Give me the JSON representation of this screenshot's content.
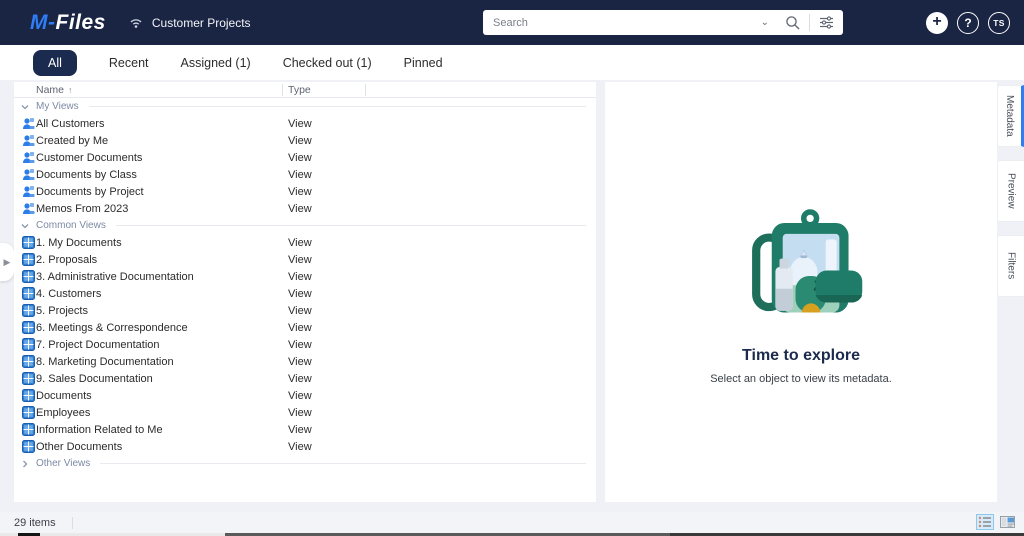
{
  "colors": {
    "topbar_bg": "#1a2443",
    "accent_blue": "#2e7df6",
    "active_tab_bg": "#1b2a4f",
    "illustration_teal": "#1f7c68"
  },
  "topbar": {
    "logo_prefix": "M-",
    "logo_suffix": "Files",
    "vault_name": "Customer Projects",
    "search": {
      "placeholder": "Search"
    },
    "avatar_initials": "TS",
    "plus_glyph": "+",
    "help_glyph": "?"
  },
  "tabs": [
    {
      "label": "All",
      "active": true
    },
    {
      "label": "Recent",
      "active": false
    },
    {
      "label": "Assigned (1)",
      "active": false
    },
    {
      "label": "Checked out (1)",
      "active": false
    },
    {
      "label": "Pinned",
      "active": false
    }
  ],
  "listing": {
    "columns": [
      {
        "label": "Name",
        "sort": "asc"
      },
      {
        "label": "Type",
        "sort": null
      }
    ],
    "groups": [
      {
        "label": "My Views",
        "expanded": true,
        "icon": "person",
        "item_type": "View",
        "items": [
          "All Customers",
          "Created by Me",
          "Customer Documents",
          "Documents by Class",
          "Documents by Project",
          "Memos From 2023"
        ]
      },
      {
        "label": "Common Views",
        "expanded": true,
        "icon": "grid",
        "item_type": "View",
        "items": [
          "1. My Documents",
          "2. Proposals",
          "3. Administrative Documentation",
          "4. Customers",
          "5. Projects",
          "6. Meetings & Correspondence",
          "7. Project Documentation",
          "8. Marketing Documentation",
          "9. Sales Documentation",
          "Documents",
          "Employees",
          "Information Related to Me",
          "Other Documents"
        ]
      },
      {
        "label": "Other Views",
        "expanded": false,
        "icon": null,
        "item_type": null,
        "items": []
      }
    ]
  },
  "metadata_panel": {
    "title": "Time to explore",
    "subtitle": "Select an object to view its metadata."
  },
  "side_tabs": [
    {
      "label": "Metadata",
      "active": true
    },
    {
      "label": "Preview",
      "active": false
    },
    {
      "label": "Filters",
      "active": false
    }
  ],
  "statusbar": {
    "item_count": "29 items"
  }
}
